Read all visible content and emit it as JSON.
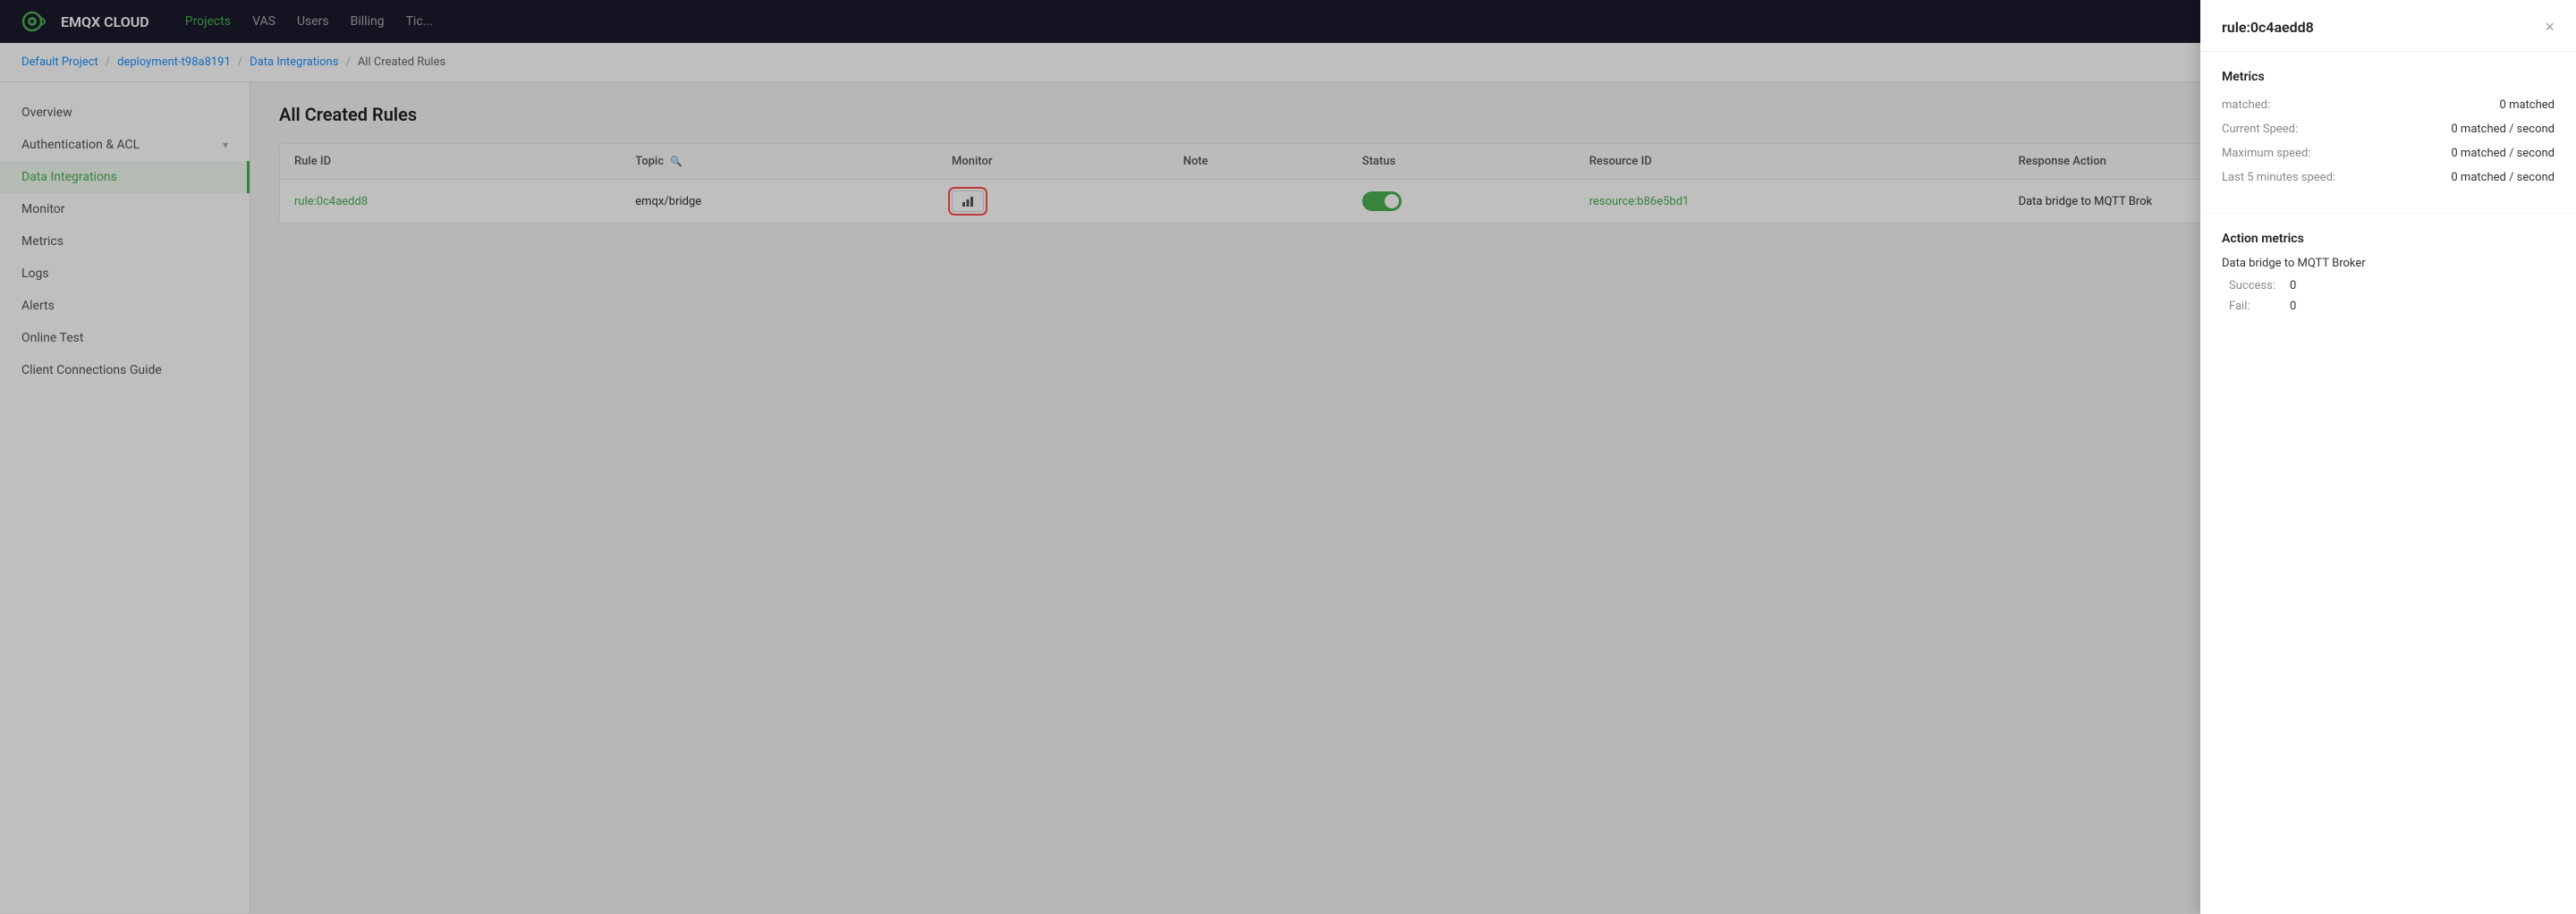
{
  "header": {
    "logo_text": "EMQX CLOUD",
    "nav": [
      {
        "label": "Projects",
        "active": true,
        "dropdown": true
      },
      {
        "label": "VAS",
        "active": false
      },
      {
        "label": "Users",
        "active": false
      },
      {
        "label": "Billing",
        "active": false,
        "dropdown": true
      },
      {
        "label": "Tic...",
        "active": false
      }
    ]
  },
  "breadcrumb": {
    "items": [
      {
        "label": "Default Project",
        "link": true
      },
      {
        "label": "deployment-t98a8191",
        "link": true
      },
      {
        "label": "Data Integrations",
        "link": true
      },
      {
        "label": "All Created Rules",
        "link": false
      }
    ]
  },
  "sidebar": {
    "items": [
      {
        "label": "Overview",
        "active": false
      },
      {
        "label": "Authentication & ACL",
        "active": false,
        "arrow": true
      },
      {
        "label": "Data Integrations",
        "active": true
      },
      {
        "label": "Monitor",
        "active": false
      },
      {
        "label": "Metrics",
        "active": false
      },
      {
        "label": "Logs",
        "active": false
      },
      {
        "label": "Alerts",
        "active": false
      },
      {
        "label": "Online Test",
        "active": false
      },
      {
        "label": "Client Connections Guide",
        "active": false
      }
    ]
  },
  "main": {
    "title": "All Created Rules",
    "table": {
      "columns": [
        "Rule ID",
        "Topic",
        "Monitor",
        "Note",
        "Status",
        "Resource ID",
        "Response Action"
      ],
      "rows": [
        {
          "rule_id": "rule:0c4aedd8",
          "topic": "emqx/bridge",
          "monitor_icon": "bar-chart",
          "note": "",
          "status": "enabled",
          "resource_id": "resource:b86e5bd1",
          "response_action": "Data bridge to MQTT Brok"
        }
      ]
    }
  },
  "panel": {
    "title": "rule:0c4aedd8",
    "close_label": "×",
    "metrics_section": {
      "title": "Metrics",
      "rows": [
        {
          "label": "matched:",
          "value": "0 matched"
        },
        {
          "label": "Current Speed:",
          "value": "0 matched / second"
        },
        {
          "label": "Maximum speed:",
          "value": "0 matched / second"
        },
        {
          "label": "Last 5 minutes speed:",
          "value": "0 matched / second"
        }
      ]
    },
    "action_metrics_section": {
      "title": "Action metrics",
      "subsection_title": "Data bridge to MQTT Broker",
      "rows": [
        {
          "label": "Success:",
          "value": "0"
        },
        {
          "label": "Fail:",
          "value": "0"
        }
      ]
    }
  }
}
